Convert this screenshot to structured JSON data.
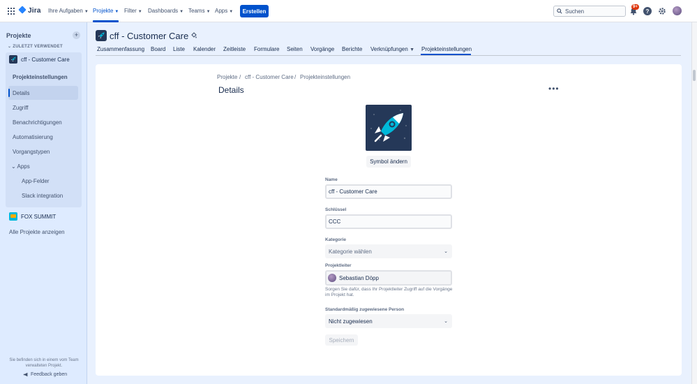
{
  "topnav": {
    "logo": "Jira",
    "items": [
      {
        "label": "Ihre Aufgaben",
        "caret": true
      },
      {
        "label": "Projekte",
        "caret": true
      },
      {
        "label": "Filter",
        "caret": true
      },
      {
        "label": "Dashboards",
        "caret": true
      },
      {
        "label": "Teams",
        "caret": true
      },
      {
        "label": "Apps",
        "caret": true
      }
    ],
    "create_label": "Erstellen",
    "search_placeholder": "Suchen",
    "notification_badge": "9+",
    "help_glyph": "?"
  },
  "sidebar": {
    "title": "Projekte",
    "add_glyph": "+",
    "recent_label": "ZULETZT VERWENDET",
    "project_name": "cff - Customer Care",
    "settings_label": "Projekteinstellungen",
    "items": [
      "Details",
      "Zugriff",
      "Benachrichtigungen",
      "Automatisierung",
      "Vorgangstypen"
    ],
    "apps_label": "Apps",
    "app_items": [
      "App-Felder",
      "Slack integration"
    ],
    "other_project": "FOX SUMMIT",
    "all_projects": "Alle Projekte anzeigen",
    "note": "Sie befinden sich in einem vom Team verwalteten Projekt.",
    "feedback": "Feedback geben"
  },
  "header": {
    "project_title": "cff - Customer Care",
    "tabs": [
      "Zusammenfassung",
      "Board",
      "Liste",
      "Kalender",
      "Zeitleiste",
      "Formulare",
      "Seiten",
      "Vorgänge",
      "Berichte",
      "Verknüpfungen",
      "Projekteinstellungen"
    ]
  },
  "content": {
    "breadcrumb": [
      "Projekte",
      "cff - Customer Care",
      "Projekteinstellungen"
    ],
    "breadcrumb_sep": "/",
    "title": "Details",
    "more_glyph": "•••",
    "change_icon_label": "Symbol ändern",
    "name_label": "Name",
    "name_value": "cff - Customer Care",
    "key_label": "Schlüssel",
    "key_value": "CCC",
    "category_label": "Kategorie",
    "category_placeholder": "Kategorie wählen",
    "lead_label": "Projektleiter",
    "lead_value": "Sebastian Döpp",
    "lead_helper": "Sorgen Sie dafür, dass Ihr Projektleiter Zugriff auf die Vorgänge im Projekt hat.",
    "assignee_label": "Standardmäßig zugewiesene Person",
    "assignee_value": "Nicht zugewiesen",
    "save_label": "Speichern"
  },
  "colors": {
    "accent": "#0052CC",
    "sidebar_bg": "#DEEBFF",
    "project_icon_bg": "#253858",
    "rocket": "#00B8D9"
  }
}
